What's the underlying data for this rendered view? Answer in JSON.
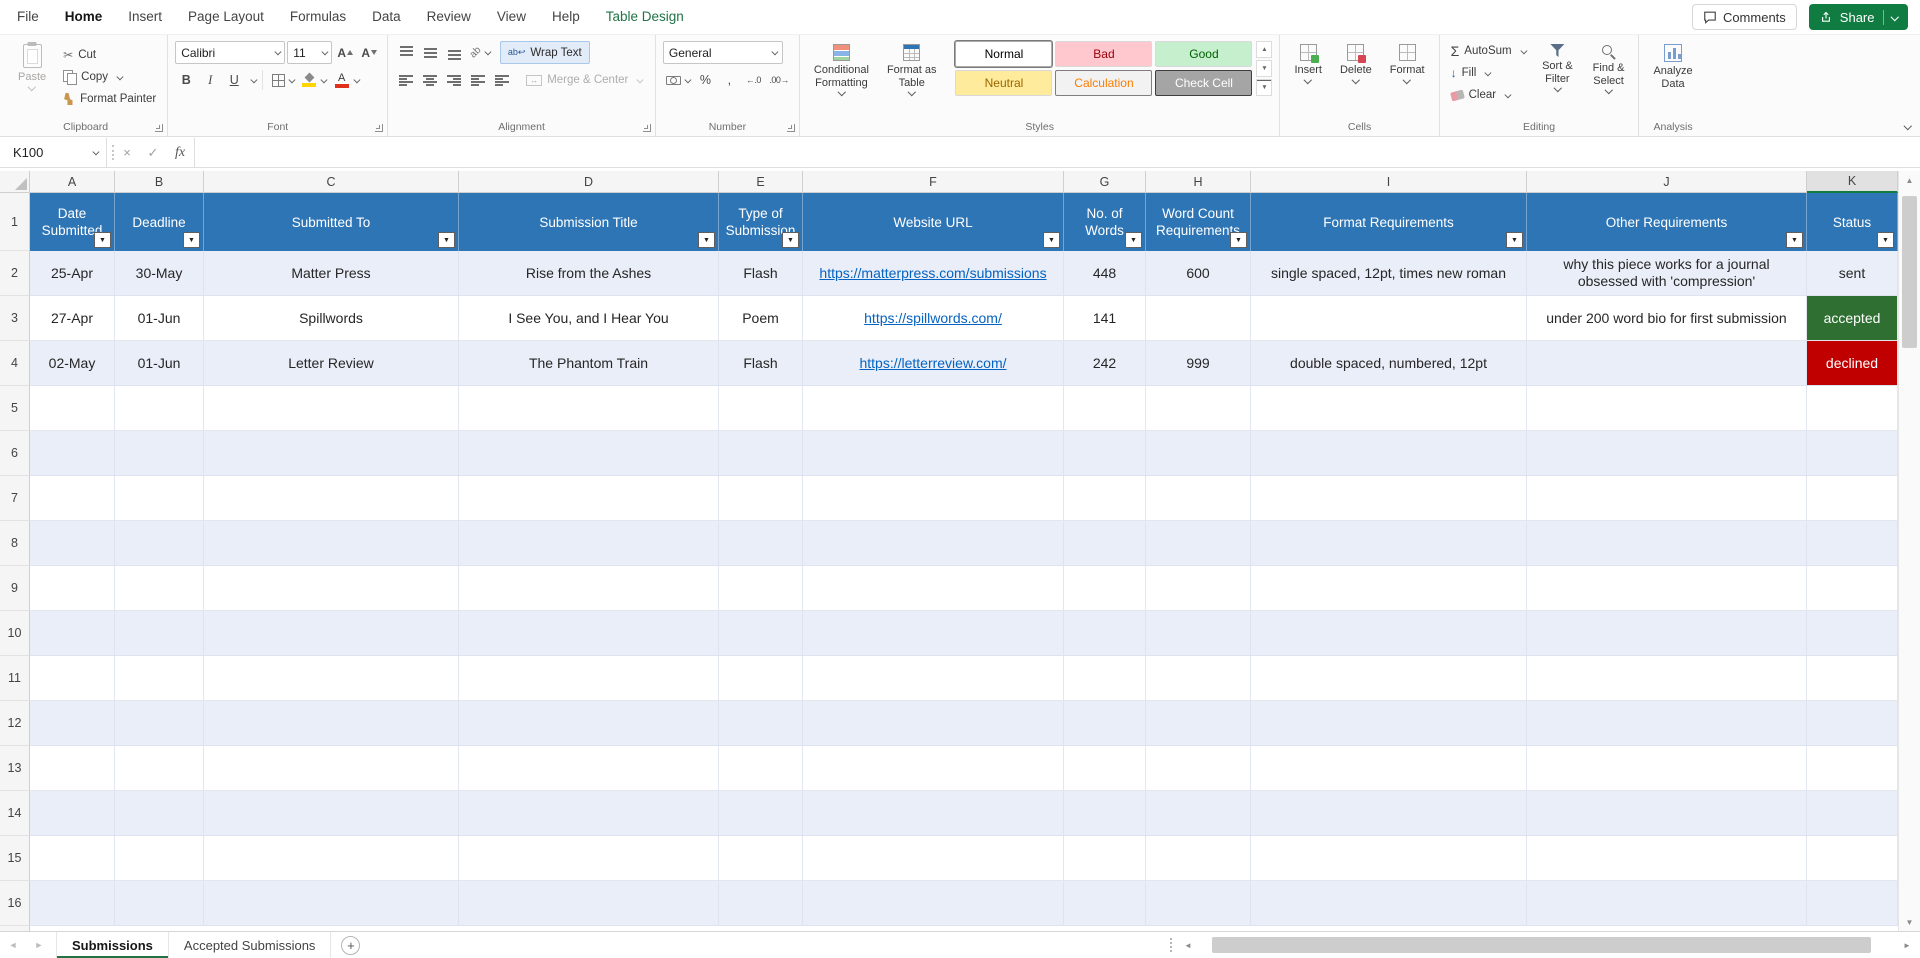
{
  "colors": {
    "table_header_blue": "#2E75B6",
    "band_row_blue": "#E9EEF8",
    "accepted_green": "#2F7032",
    "declined_red": "#C00000",
    "hyperlink_blue": "#0563C1",
    "excel_green": "#107C41",
    "contextual_tab_green": "#217346"
  },
  "menu": {
    "tabs": [
      "File",
      "Home",
      "Insert",
      "Page Layout",
      "Formulas",
      "Data",
      "Review",
      "View",
      "Help",
      "Table Design"
    ],
    "active_tab": "Home",
    "contextual_tab": "Table Design",
    "comments": "Comments",
    "share": "Share"
  },
  "ribbon": {
    "clipboard": {
      "label": "Clipboard",
      "paste": "Paste",
      "cut": "Cut",
      "copy": "Copy",
      "format_painter": "Format Painter"
    },
    "font": {
      "label": "Font",
      "family": "Calibri",
      "size": "11"
    },
    "alignment": {
      "label": "Alignment",
      "wrap_text": "Wrap Text",
      "merge_center": "Merge & Center"
    },
    "number": {
      "label": "Number",
      "format": "General"
    },
    "styles": {
      "label": "Styles",
      "conditional_formatting": "Conditional\nFormatting",
      "format_as_table": "Format as\nTable",
      "items": [
        {
          "label": "Normal",
          "bg": "#FFFFFF",
          "fg": "#000000",
          "border": "#ABABAB",
          "selected": true
        },
        {
          "label": "Bad",
          "bg": "#FFC7CE",
          "fg": "#9C0006"
        },
        {
          "label": "Good",
          "bg": "#C6EFCE",
          "fg": "#006100"
        },
        {
          "label": "Neutral",
          "bg": "#FFEB9C",
          "fg": "#9C6500"
        },
        {
          "label": "Calculation",
          "bg": "#F2F2F2",
          "fg": "#FA7D00",
          "border": "#7F7F7F"
        },
        {
          "label": "Check Cell",
          "bg": "#A5A5A5",
          "fg": "#FFFFFF",
          "border": "#3F3F3F"
        }
      ]
    },
    "cells": {
      "label": "Cells",
      "insert": "Insert",
      "delete": "Delete",
      "format": "Format"
    },
    "editing": {
      "label": "Editing",
      "autosum": "AutoSum",
      "fill": "Fill",
      "clear": "Clear",
      "sort_filter": "Sort &\nFilter",
      "find_select": "Find &\nSelect"
    },
    "analysis": {
      "label": "Analysis",
      "analyze_data": "Analyze\nData"
    }
  },
  "formula_bar": {
    "name_box": "K100",
    "fx": "fx",
    "value": ""
  },
  "sheet": {
    "column_letters": [
      "A",
      "B",
      "C",
      "D",
      "E",
      "F",
      "G",
      "H",
      "I",
      "J",
      "K"
    ],
    "selected_column": "K",
    "visible_rows": 16,
    "table_headers": [
      "Date Submitted",
      "Deadline",
      "Submitted To",
      "Submission Title",
      "Type of Submission",
      "Website URL",
      "No. of Words",
      "Word Count Requirements",
      "Format Requirements",
      "Other Requirements",
      "Status"
    ],
    "link_column_index": 5,
    "status_column_index": 10,
    "rows": [
      {
        "cells": [
          "25-Apr",
          "30-May",
          "Matter Press",
          "Rise from the Ashes",
          "Flash",
          "https://matterpress.com/submissions",
          "448",
          "600",
          "single spaced, 12pt, times new roman",
          "why this piece works for a journal obsessed with 'compression'",
          "sent"
        ],
        "status_style": "plain"
      },
      {
        "cells": [
          "27-Apr",
          "01-Jun",
          "Spillwords",
          "I See You, and I Hear You",
          "Poem",
          "https://spillwords.com/",
          "141",
          "",
          "",
          "under 200 word bio for first submission",
          "accepted"
        ],
        "status_style": "accepted"
      },
      {
        "cells": [
          "02-May",
          "01-Jun",
          "Letter Review",
          "The Phantom Train",
          "Flash",
          "https://letterreview.com/",
          "242",
          "999",
          "double spaced, numbered, 12pt",
          "",
          "declined"
        ],
        "status_style": "declined"
      }
    ]
  },
  "sheet_tabs": {
    "tabs": [
      "Submissions",
      "Accepted Submissions"
    ],
    "active_tab": "Submissions",
    "add_label": "+"
  }
}
